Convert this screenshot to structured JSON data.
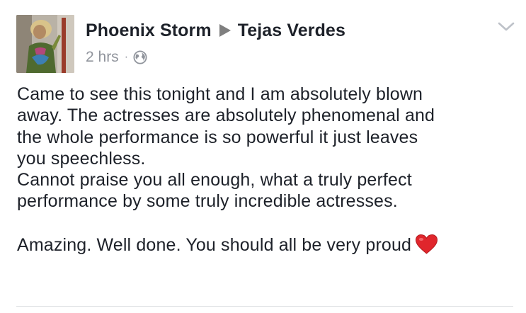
{
  "post": {
    "author": "Phoenix Storm",
    "target_page": "Tejas Verdes",
    "timestamp": "2 hrs",
    "separator": "·",
    "privacy_icon": "globe-icon",
    "options_icon": "chevron-down-icon",
    "body_lines": [
      "Came to see this tonight and I am absolutely blown",
      "away. The actresses are absolutely phenomenal and",
      "the whole performance is so powerful it just leaves",
      "you speechless.",
      "Cannot praise you all enough, what a truly perfect",
      "performance by some truly incredible actresses."
    ],
    "closing_line": "Amazing. Well done. You should all be very proud",
    "closing_emoji": "heart-icon"
  },
  "colors": {
    "text": "#1d2129",
    "meta": "#90949c",
    "arrow": "#7f7f7f",
    "heart": "#e0262c",
    "divider": "#dddfe2"
  }
}
